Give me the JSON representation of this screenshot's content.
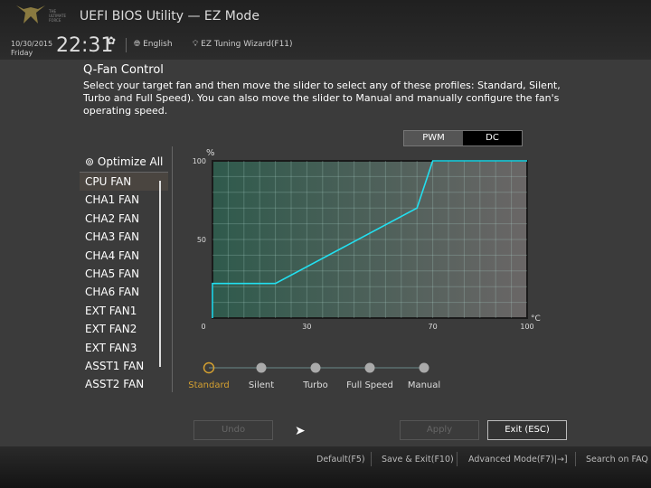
{
  "header": {
    "title": "UEFI BIOS Utility — EZ Mode",
    "date": "10/30/2015",
    "day": "Friday",
    "time": "22:31",
    "language": "English",
    "wizard": "EZ Tuning Wizard(F11)",
    "logo_text": "THE ULTIMATE FORCE"
  },
  "qfan": {
    "title": "Q-Fan Control",
    "description": "Select your target fan and then move the slider to select any of these profiles: Standard, Silent, Turbo and Full Speed). You can also move the slider to Manual and manually configure the fan's operating speed.",
    "optimize_all": "Optimize All",
    "fans": [
      "CPU FAN",
      "CHA1 FAN",
      "CHA2 FAN",
      "CHA3 FAN",
      "CHA4 FAN",
      "CHA5 FAN",
      "CHA6 FAN",
      "EXT FAN1",
      "EXT FAN2",
      "EXT FAN3",
      "ASST1 FAN",
      "ASST2 FAN"
    ],
    "selected_fan": "CPU FAN",
    "mode_toggle": [
      "PWM",
      "DC"
    ],
    "mode_selected": "DC",
    "profiles": [
      "Standard",
      "Silent",
      "Turbo",
      "Full Speed",
      "Manual"
    ],
    "selected_profile": "Standard"
  },
  "chart_data": {
    "type": "line",
    "xlabel": "°C",
    "ylabel": "%",
    "xlim": [
      0,
      100
    ],
    "ylim": [
      0,
      100
    ],
    "xticks": [
      0,
      30,
      70,
      100
    ],
    "yticks": [
      50,
      100
    ],
    "grid": true,
    "series": [
      {
        "x": [
          0,
          0,
          20,
          65,
          70,
          100
        ],
        "y": [
          0,
          22,
          22,
          70,
          100,
          100
        ],
        "color": "#22e0f0"
      }
    ]
  },
  "buttons": {
    "undo": "Undo",
    "apply": "Apply",
    "exit": "Exit (ESC)"
  },
  "footer": {
    "default": "Default(F5)",
    "save_exit": "Save & Exit(F10)",
    "advanced": "Advanced Mode(F7)|→]",
    "faq": "Search on FAQ"
  },
  "colors": {
    "accent": "#22e0f0",
    "profile_active": "#d4a030"
  }
}
